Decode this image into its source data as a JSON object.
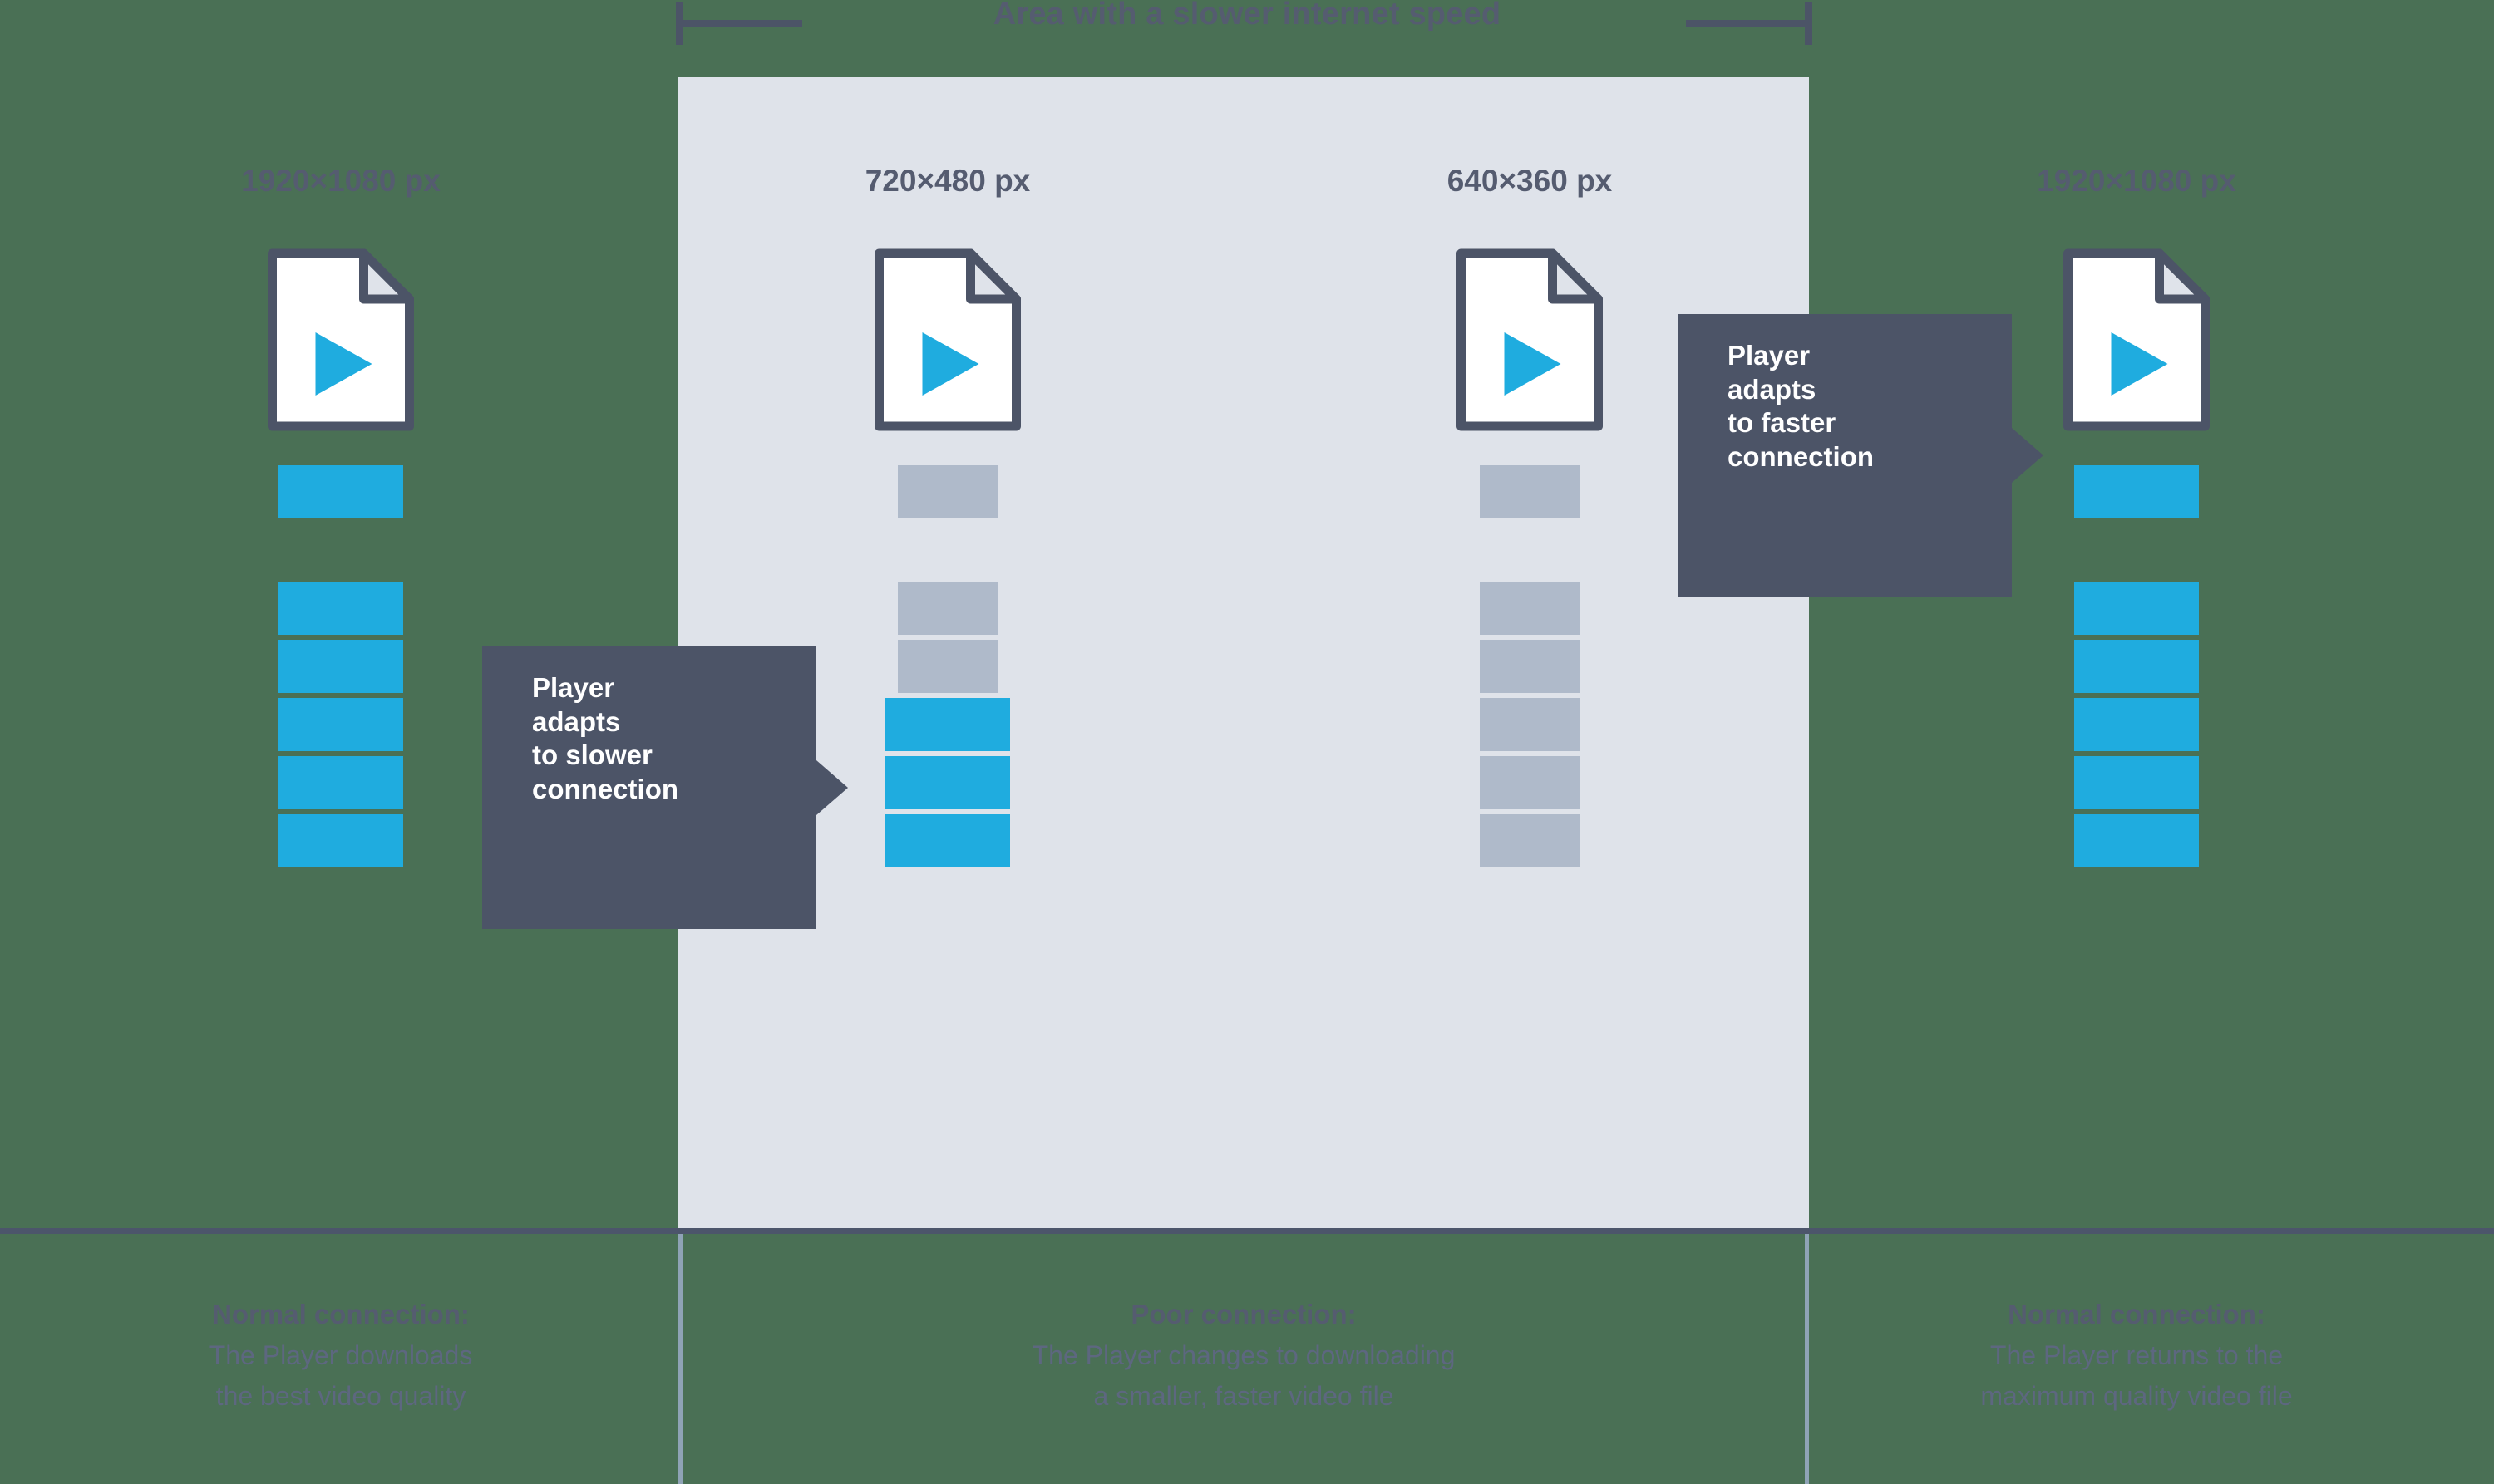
{
  "diagram": {
    "bracket": {
      "label": "Area with a slower internet speed"
    },
    "columns": [
      {
        "id": "col-normal-before",
        "resolution": "1920×1080 px",
        "icon": "video-file-icon",
        "segments": [
          "blue",
          "blue",
          "blue",
          "blue",
          "blue",
          "blue"
        ],
        "caption": {
          "title": "Normal connection:",
          "line1": "The Player downloads",
          "line2": "the best video quality"
        }
      },
      {
        "id": "col-poor-720",
        "resolution": "720×480 px",
        "icon": "video-file-icon",
        "segments": [
          "gray",
          "gray",
          "gray",
          "blue",
          "blue",
          "blue"
        ],
        "caption": {
          "title": "Poor connection:",
          "line1": "The Player changes to downloading",
          "line2": "a smaller, faster video file"
        }
      },
      {
        "id": "col-poor-640",
        "resolution": "640×360 px",
        "icon": "video-file-icon",
        "segments": [
          "gray",
          "gray",
          "gray",
          "gray",
          "gray",
          "gray"
        ],
        "caption": null
      },
      {
        "id": "col-normal-after",
        "resolution": "1920×1080 px",
        "icon": "video-file-icon",
        "segments": [
          "blue",
          "blue",
          "blue",
          "blue",
          "blue",
          "blue"
        ],
        "caption": {
          "title": "Normal connection:",
          "line1": "The Player returns to the",
          "line2": "maximum quality video file"
        }
      }
    ],
    "callouts": [
      {
        "id": "callout-slower",
        "line1": "Player",
        "line2": "adapts",
        "line3": "to slower",
        "line4": "connection"
      },
      {
        "id": "callout-faster",
        "line1": "Player",
        "line2": "adapts",
        "line3": "to faster",
        "line4": "connection"
      }
    ],
    "colors": {
      "accent_blue": "#1facdf",
      "segment_gray": "#afbaca",
      "panel_background": "#dfe3ea",
      "text_dark": "#555c70",
      "callout_background": "#4c5467",
      "outline": "#4c5467",
      "divider": "#8fa3b6"
    }
  }
}
